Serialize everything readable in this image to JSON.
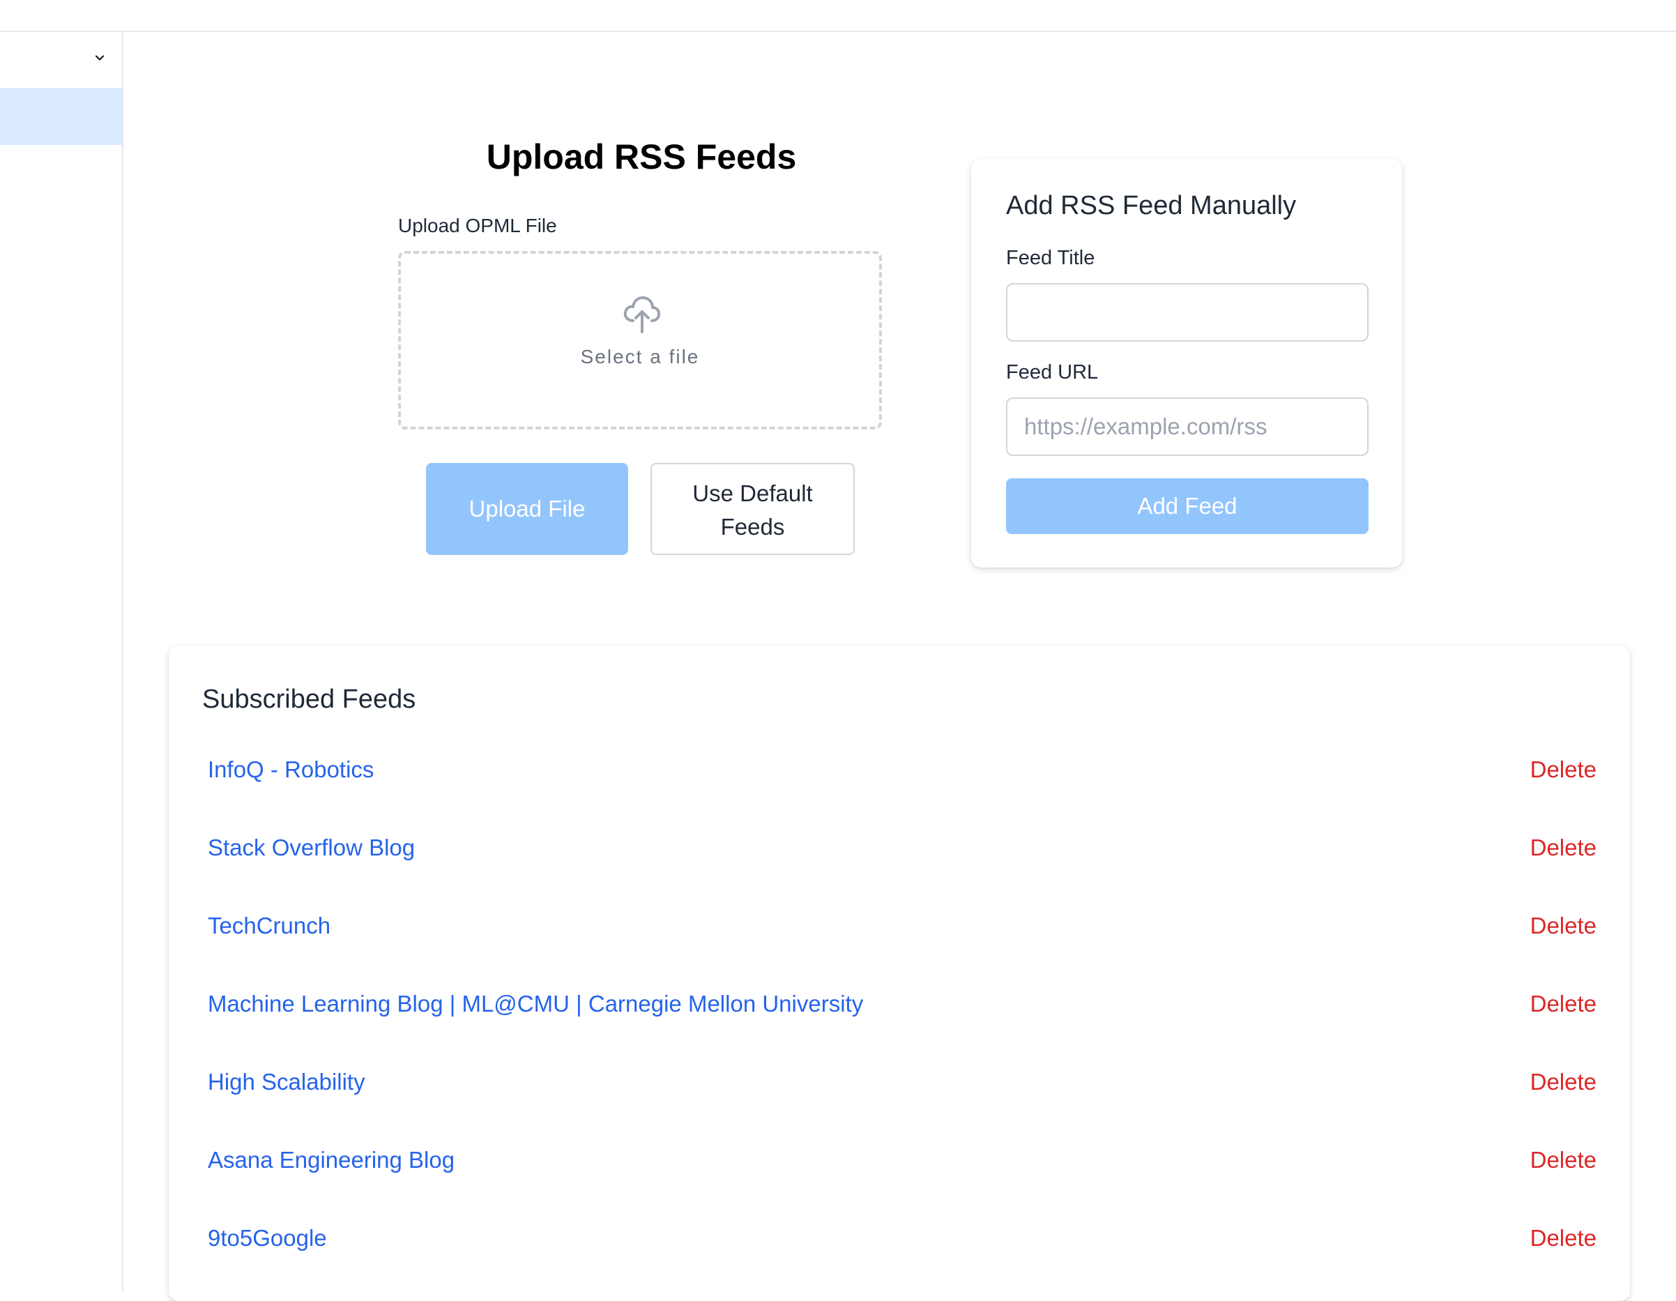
{
  "upload": {
    "title": "Upload RSS Feeds",
    "opml_label": "Upload OPML File",
    "dropzone_text": "Select a file",
    "upload_button": "Upload File",
    "default_button": "Use Default Feeds"
  },
  "manual": {
    "title": "Add RSS Feed Manually",
    "feed_title_label": "Feed Title",
    "feed_title_value": "",
    "feed_url_label": "Feed URL",
    "feed_url_placeholder": "https://example.com/rss",
    "add_button": "Add Feed"
  },
  "subscribed": {
    "title": "Subscribed Feeds",
    "delete_label": "Delete",
    "feeds": [
      {
        "title": "InfoQ - Robotics"
      },
      {
        "title": "Stack Overflow Blog"
      },
      {
        "title": "TechCrunch"
      },
      {
        "title": "Machine Learning Blog | ML@CMU | Carnegie Mellon University"
      },
      {
        "title": "High Scalability"
      },
      {
        "title": "Asana Engineering Blog"
      },
      {
        "title": "9to5Google"
      }
    ]
  },
  "colors": {
    "link": "#2563eb",
    "danger": "#dc2626",
    "primary_disabled": "#93c5fd",
    "sidebar_active": "#dbeafe"
  },
  "icons": {
    "sidebar_toggle": "chevron-down-icon",
    "dropzone": "cloud-upload-icon"
  }
}
